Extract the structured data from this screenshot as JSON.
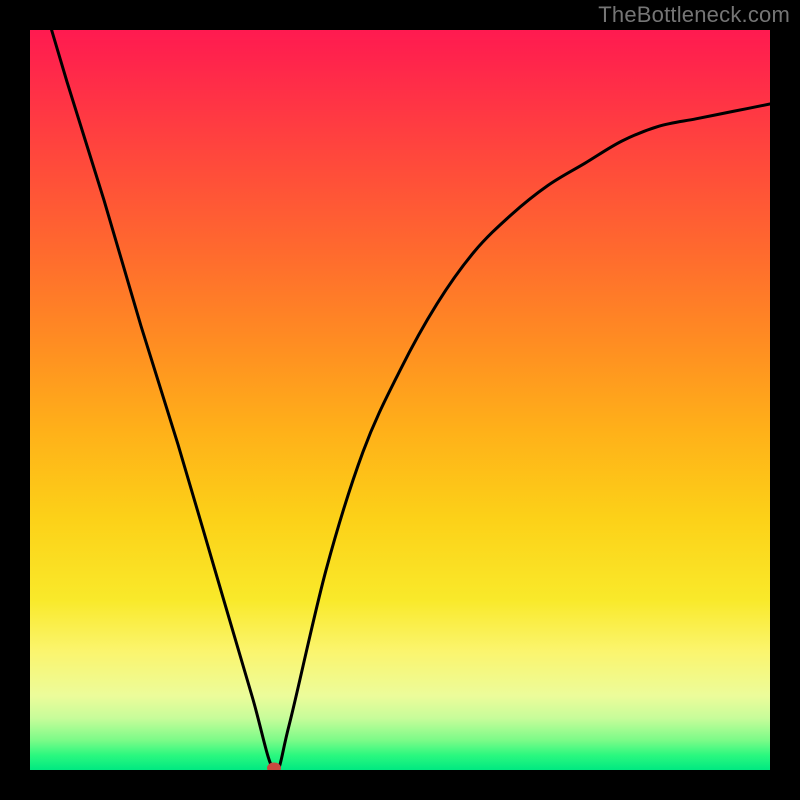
{
  "watermark": "TheBottleneck.com",
  "chart_data": {
    "type": "line",
    "title": "",
    "xlabel": "",
    "ylabel": "",
    "x": [
      0.0,
      0.05,
      0.1,
      0.15,
      0.2,
      0.25,
      0.3,
      0.33,
      0.35,
      0.4,
      0.45,
      0.5,
      0.55,
      0.6,
      0.65,
      0.7,
      0.75,
      0.8,
      0.85,
      0.9,
      0.95,
      1.0
    ],
    "values": [
      1.1,
      0.93,
      0.77,
      0.6,
      0.44,
      0.27,
      0.1,
      0.0,
      0.06,
      0.27,
      0.43,
      0.54,
      0.63,
      0.7,
      0.75,
      0.79,
      0.82,
      0.85,
      0.87,
      0.88,
      0.89,
      0.9
    ],
    "xlim": [
      0,
      1
    ],
    "ylim": [
      0,
      1
    ],
    "min_point": {
      "x": 0.33,
      "y": 0.0
    },
    "background_gradient": {
      "top": "#ff1a50",
      "middle": "#ffb019",
      "bottom": "#00e981"
    },
    "curve_color": "#000000",
    "marker_color": "#c94a3f"
  }
}
